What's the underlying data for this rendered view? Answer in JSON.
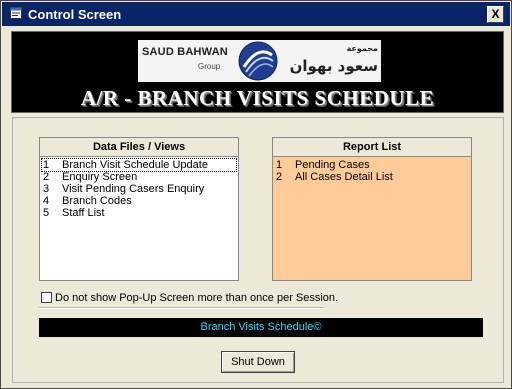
{
  "window": {
    "title": "Control Screen",
    "close_label": "X",
    "title_icon": "form-icon",
    "close_icon": "close-icon"
  },
  "banner": {
    "company_en": "SAUD BAHWAN",
    "company_group": "Group",
    "company_ar_top": "مجموعة",
    "company_ar": "سعود بهوان",
    "title": "A/R - BRANCH VISITS SCHEDULE"
  },
  "data_files": {
    "header": "Data Files / Views",
    "items": [
      {
        "num": "1",
        "label": "Branch Visit Schedule Update"
      },
      {
        "num": "2",
        "label": "Enquiry Screen"
      },
      {
        "num": "3",
        "label": "Visit Pending Casers Enquiry"
      },
      {
        "num": "4",
        "label": "Branch Codes"
      },
      {
        "num": "5",
        "label": "Staff List"
      }
    ],
    "selected_index": 0
  },
  "report_list": {
    "header": "Report List",
    "items": [
      {
        "num": "1",
        "label": "Pending Cases"
      },
      {
        "num": "2",
        "label": "All Cases Detail List"
      }
    ]
  },
  "popup_option": {
    "label": "Do not show Pop-Up Screen more than once per Session.",
    "checked": false
  },
  "status": {
    "text": "Branch Visits Schedule©"
  },
  "shutdown_button": {
    "label": "Shut Down"
  },
  "colors": {
    "title_bar": "#0a246a",
    "background": "#ece9d8",
    "report_list_bg": "#ffcc99",
    "status_text": "#2cd7ff",
    "banner_bg": "#000000"
  }
}
